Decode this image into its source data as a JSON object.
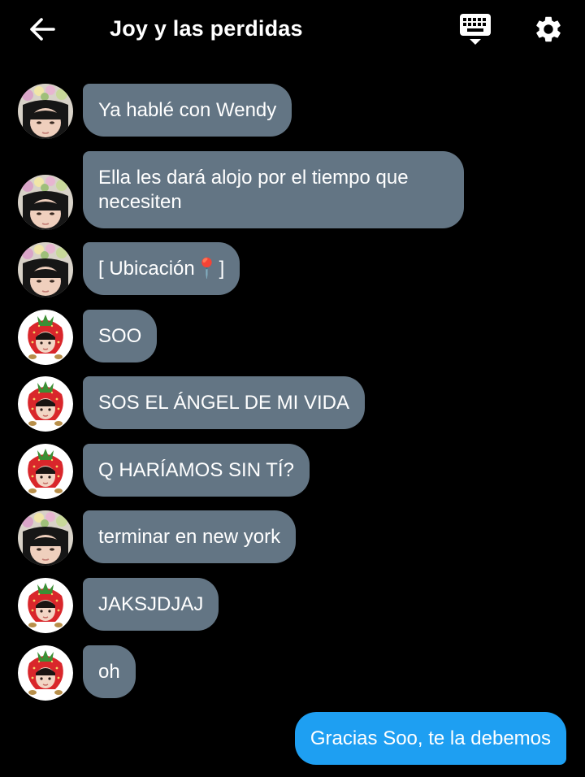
{
  "header": {
    "title": "Joy y las perdidas",
    "back_icon": "arrow-left-icon",
    "keyboard_icon": "keyboard-icon",
    "settings_icon": "gear-icon"
  },
  "colors": {
    "background": "#000000",
    "incoming_bubble": "#637584",
    "outgoing_bubble": "#1e9ff2"
  },
  "messages": [
    {
      "sender": "flower-crown-avatar",
      "text": "Ya hablé con Wendy"
    },
    {
      "sender": "flower-crown-avatar",
      "text": "Ella les dará alojo por el tiempo que necesiten"
    },
    {
      "sender": "flower-crown-avatar",
      "text": "[ Ubicación📍]"
    },
    {
      "sender": "strawberry-avatar",
      "text": "SOO"
    },
    {
      "sender": "strawberry-avatar",
      "text": "SOS EL ÁNGEL DE MI VIDA"
    },
    {
      "sender": "strawberry-avatar",
      "text": "Q HARÍAMOS SIN TÍ?"
    },
    {
      "sender": "flower-crown-avatar",
      "text": "terminar en new york"
    },
    {
      "sender": "strawberry-avatar",
      "text": "JAKSJDJAJ"
    },
    {
      "sender": "strawberry-avatar",
      "text": "oh"
    },
    {
      "sender": "me",
      "text": "Gracias Soo, te la debemos"
    }
  ]
}
